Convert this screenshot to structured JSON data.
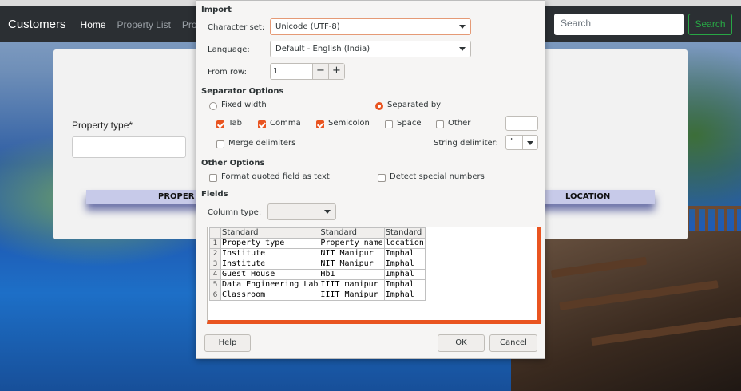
{
  "navbar": {
    "brand": "Customers",
    "links": [
      "Home",
      "Property List",
      "Prope"
    ],
    "search_placeholder": "Search",
    "search_button": "Search"
  },
  "page": {
    "property_type_label": "Property type*",
    "table_headers": [
      "PROPER",
      "LOCATION"
    ]
  },
  "dialog": {
    "import_title": "Import",
    "charset_label": "Character set:",
    "charset_value": "Unicode (UTF-8)",
    "language_label": "Language:",
    "language_value": "Default - English (India)",
    "from_row_label": "From row:",
    "from_row_value": "1",
    "separator_title": "Separator Options",
    "fixed_width": "Fixed width",
    "separated_by": "Separated by",
    "tab": "Tab",
    "comma": "Comma",
    "semicolon": "Semicolon",
    "space": "Space",
    "other": "Other",
    "merge_delimiters": "Merge delimiters",
    "string_delimiter_label": "String delimiter:",
    "string_delimiter_value": "\"",
    "other_options_title": "Other Options",
    "format_quoted": "Format quoted field as text",
    "detect_special": "Detect special numbers",
    "fields_title": "Fields",
    "column_type_label": "Column type:",
    "grid": {
      "header": [
        "Standard",
        "Standard",
        "Standard"
      ],
      "rows": [
        [
          "1",
          "Property_type",
          "Property_name",
          "location"
        ],
        [
          "2",
          "Institute",
          "NIT Manipur",
          "Imphal"
        ],
        [
          "3",
          "Institute",
          "NIT Manipur",
          "Imphal"
        ],
        [
          "4",
          "Guest House",
          "Hb1",
          "Imphal"
        ],
        [
          "5",
          "Data Engineering Lab",
          "IIIT manipur",
          "Imphal"
        ],
        [
          "6",
          "Classroom",
          "IIIT Manipur",
          "Imphal"
        ]
      ]
    },
    "help_button": "Help",
    "ok_button": "OK",
    "cancel_button": "Cancel"
  },
  "colors": {
    "accent": "#e95420",
    "navbar_bg": "#2b2f33",
    "success": "#28a745"
  }
}
